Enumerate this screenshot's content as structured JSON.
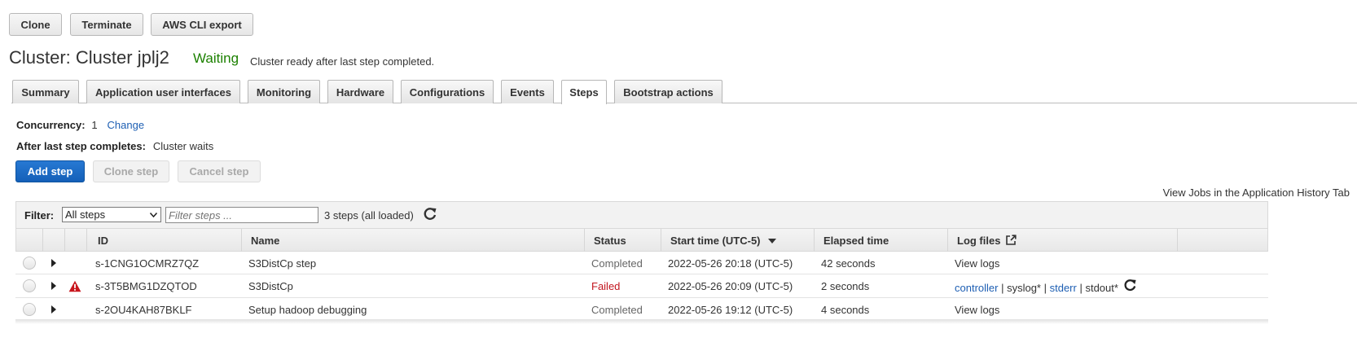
{
  "toolbar": {
    "clone": "Clone",
    "terminate": "Terminate",
    "aws_cli_export": "AWS CLI export"
  },
  "cluster": {
    "title": "Cluster: Cluster jplj2",
    "state": "Waiting",
    "state_message": "Cluster ready after last step completed."
  },
  "tabs": [
    {
      "label": "Summary"
    },
    {
      "label": "Application user interfaces"
    },
    {
      "label": "Monitoring"
    },
    {
      "label": "Hardware"
    },
    {
      "label": "Configurations"
    },
    {
      "label": "Events"
    },
    {
      "label": "Steps",
      "active": true
    },
    {
      "label": "Bootstrap actions"
    }
  ],
  "settings": {
    "concurrency_label": "Concurrency:",
    "concurrency_value": "1",
    "change_link": "Change",
    "after_label": "After last step completes:",
    "after_value": "Cluster waits"
  },
  "actions": {
    "add_step": "Add step",
    "clone_step": "Clone step",
    "cancel_step": "Cancel step"
  },
  "history_link": "View Jobs in the Application History Tab",
  "filter": {
    "label": "Filter:",
    "select_value": "All steps",
    "placeholder": "Filter steps ...",
    "count": "3 steps (all loaded)"
  },
  "table": {
    "columns": [
      "ID",
      "Name",
      "Status",
      "Start time (UTC-5)",
      "Elapsed time",
      "Log files"
    ],
    "rows": [
      {
        "id": "s-1CNG1OCMRZ7QZ",
        "name": "S3DistCp step",
        "status": "Completed",
        "start": "2022-05-26 20:18 (UTC-5)",
        "elapsed": "42 seconds",
        "log": "View logs"
      },
      {
        "id": "s-3T5BMG1DZQTOD",
        "name": "S3DistCp",
        "status": "Failed",
        "start": "2022-05-26 20:09 (UTC-5)",
        "elapsed": "2 seconds",
        "log_parts": {
          "controller": "controller",
          "sep1": " | ",
          "syslog": "syslog*",
          "sep2": " | ",
          "stderr": "stderr",
          "sep3": " | ",
          "stdout": "stdout*"
        }
      },
      {
        "id": "s-2OU4KAH87BKLF",
        "name": "Setup hadoop debugging",
        "status": "Completed",
        "start": "2022-05-26 19:12 (UTC-5)",
        "elapsed": "4 seconds",
        "log": "View logs"
      }
    ]
  },
  "colors": {
    "waiting": "#1d8102",
    "failed": "#c2161f",
    "link": "#1e5fb3",
    "primary": "#1460b8"
  }
}
